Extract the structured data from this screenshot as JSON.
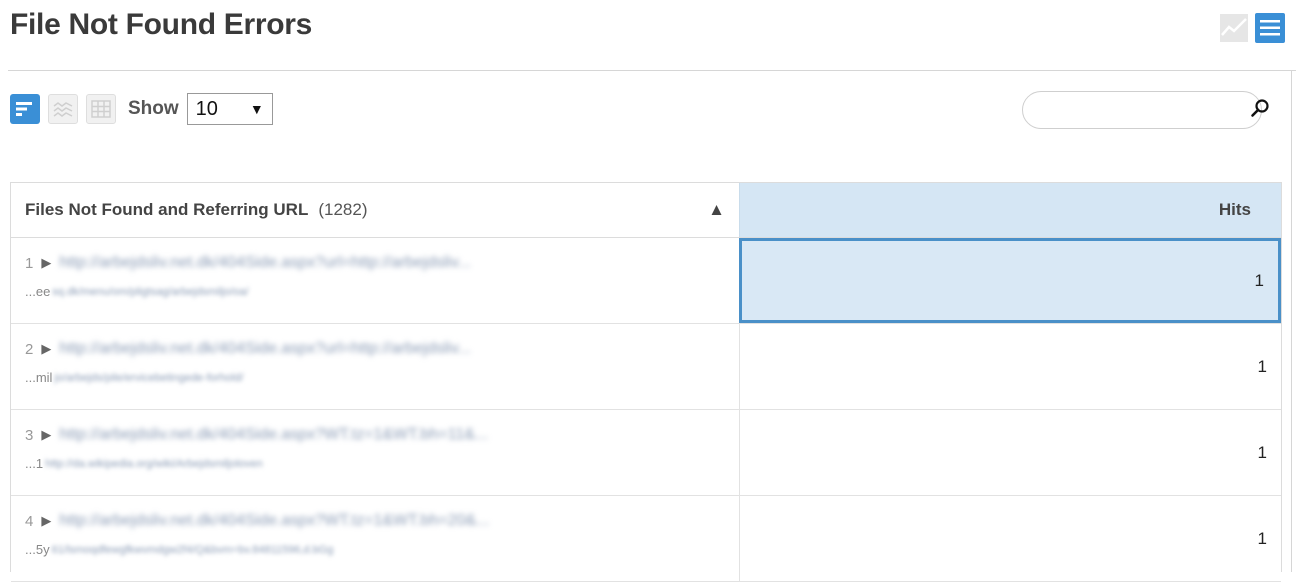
{
  "header": {
    "title": "File Not Found Errors",
    "icons": [
      "line-chart-icon",
      "list-view-icon"
    ]
  },
  "toolbar": {
    "view_icons": [
      "sort-bars-icon",
      "area-chart-icon",
      "table-grid-icon"
    ],
    "show_label": "Show",
    "show_value": "10",
    "search_placeholder": ""
  },
  "colors": {
    "accent": "#3a8fd6",
    "header_hits_bg": "#d5e6f4",
    "selected_border": "#4a90c8"
  },
  "table": {
    "col_files": "Files Not Found and Referring URL",
    "col_files_count": "(1282)",
    "col_hits": "Hits",
    "sort_indicator": "▲",
    "rows": [
      {
        "num": "1",
        "url": "http://arbejdsliv.net.dk/404Side.aspx?url=http://arbejdsliv...",
        "ref_prefix": "...ee",
        "ref": "sq.dk/menu/om/pligtsag/arbejdsmiljo/oa/",
        "hits": "1"
      },
      {
        "num": "2",
        "url": "http://arbejdsliv.net.dk/404Side.aspx?url=http://arbejdsliv...",
        "ref_prefix": "...mil",
        "ref": "jo/arbejds/pile/ervicebetingede-forhold/",
        "hits": "1"
      },
      {
        "num": "3",
        "url": "http://arbejdsliv.net.dk/404Side.aspx?WT.tz=1&WT.bh=11&...",
        "ref_prefix": "...1",
        "ref": "http://da.wikipedia.org/wiki/Arbejdsmiljoloven",
        "hits": "1"
      },
      {
        "num": "4",
        "url": "http://arbejdsliv.net.dk/404Side.aspx?WT.tz=1&WT.bh=20&...",
        "ref_prefix": "...5y",
        "ref": "61/lsmoqdfewgfkwvmdgw2f4/Q&bvm=bv.84811596,d.bGg",
        "hits": "1"
      }
    ]
  }
}
